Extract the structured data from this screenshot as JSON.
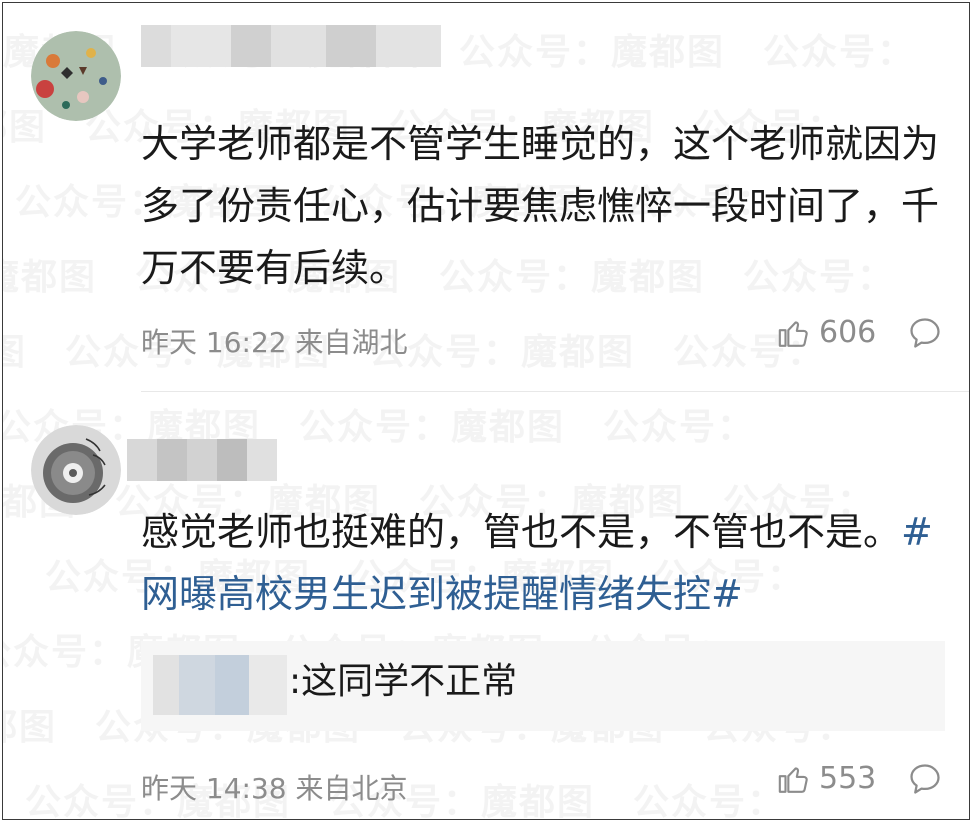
{
  "watermark": {
    "text": "魔都图　公众号："
  },
  "comments": [
    {
      "text": "大学老师都是不管学生睡觉的，这个老师就因为多了份责任心，估计要焦虑憔悴一段时间了，千万不要有后续。",
      "meta": "昨天 16:22 来自湖北",
      "likes": "606"
    },
    {
      "text_plain": "感觉老师也挺难的，管也不是，不管也不是。",
      "hashtag": "#网曝高校男生迟到被提醒情绪失控#",
      "reply": ":这同学不正常",
      "meta": "昨天 14:38 来自北京",
      "likes": "553"
    }
  ],
  "colors": {
    "hashtag": "#2f5f93",
    "meta": "#8c8c8c",
    "reply_bg": "#f6f6f6"
  },
  "icons": {
    "like": "thumbs-up-icon",
    "reply": "speech-bubble-icon"
  }
}
